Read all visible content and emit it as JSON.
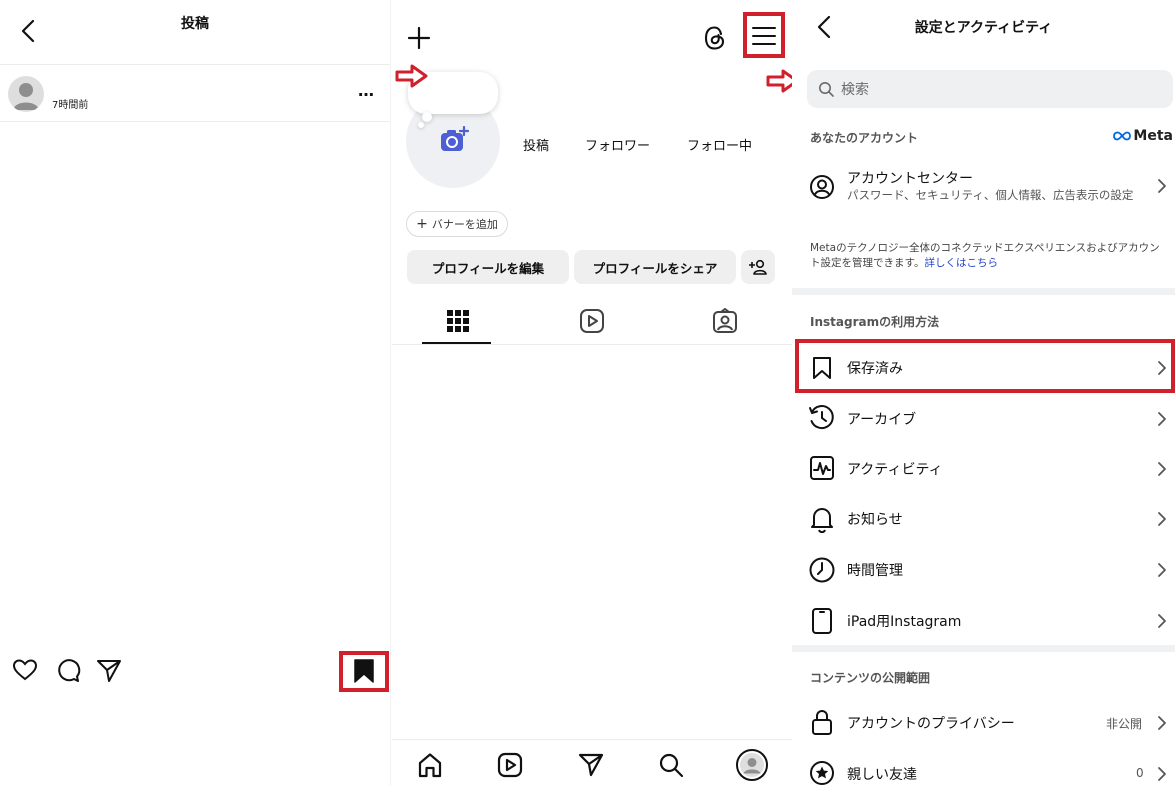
{
  "post_screen": {
    "title": "投稿",
    "time_ago": "7時間前",
    "more_label": "…"
  },
  "profile_screen": {
    "stats": {
      "posts": "投稿",
      "followers": "フォロワー",
      "following": "フォロー中"
    },
    "add_banner_label": "バナーを追加",
    "edit_profile_label": "プロフィールを編集",
    "share_profile_label": "プロフィールをシェア"
  },
  "settings_screen": {
    "title": "設定とアクティビティ",
    "search_placeholder": "検索",
    "your_account_header": "あなたのアカウント",
    "meta_logo_text": "Meta",
    "account_center": {
      "title": "アカウントセンター",
      "subtitle": "パスワード、セキュリティ、個人情報、広告表示の設定"
    },
    "meta_description": "Metaのテクノロジー全体のコネクテッドエクスペリエンスおよびアカウント設定を管理できます。",
    "meta_description_link": "詳しくはこちら",
    "how_you_use_header": "Instagramの利用方法",
    "usage_items": [
      {
        "label": "保存済み",
        "icon": "bookmark-icon"
      },
      {
        "label": "アーカイブ",
        "icon": "archive-icon"
      },
      {
        "label": "アクティビティ",
        "icon": "activity-icon"
      },
      {
        "label": "お知らせ",
        "icon": "bell-icon"
      },
      {
        "label": "時間管理",
        "icon": "clock-icon"
      },
      {
        "label": "iPad用Instagram",
        "icon": "tablet-icon"
      }
    ],
    "visibility_header": "コンテンツの公開範囲",
    "visibility_items": [
      {
        "label": "アカウントのプライバシー",
        "value": "非公開",
        "icon": "lock-icon"
      },
      {
        "label": "親しい友達",
        "value": "0",
        "icon": "star-icon"
      }
    ]
  },
  "colors": {
    "highlight_red": "#d0202b",
    "link_blue": "#2446c9",
    "camera_blue": "#4c5fd5"
  }
}
